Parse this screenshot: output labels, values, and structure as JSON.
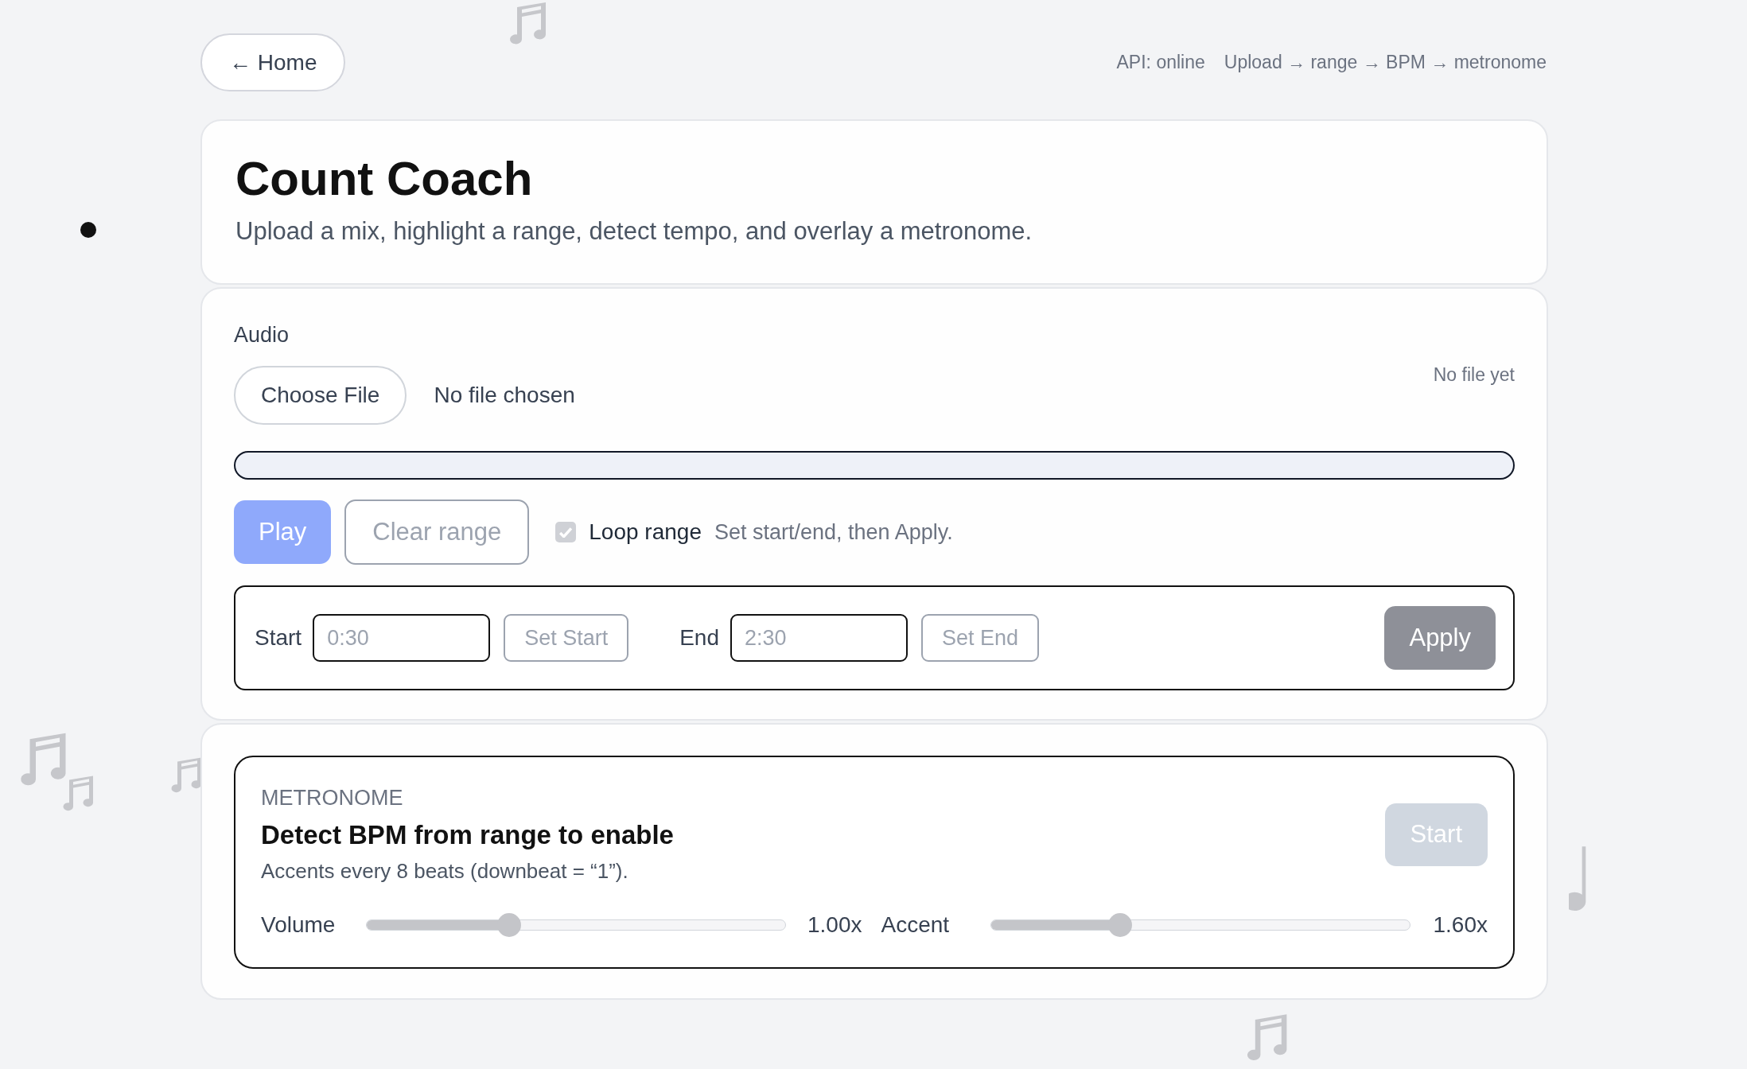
{
  "top_bar": {
    "home_button": {
      "label": "← Home"
    },
    "status_texts": [
      "API: online",
      "Upload → range → BPM → metronome"
    ]
  },
  "header": {
    "title": "Count Coach",
    "subtitle": "Upload a mix, highlight a range, detect tempo, and overlay a metronome."
  },
  "audio": {
    "label": "Audio",
    "choose_button": "Choose File",
    "file_name": "No file chosen",
    "file_status": "No file yet",
    "play_button": {
      "label": "Play",
      "disabled": true
    },
    "clear_button": {
      "label": "Clear range",
      "disabled": true
    },
    "loop": {
      "label": "Loop range",
      "checked": true,
      "disabled": true
    },
    "hint": "Set start/end, then Apply.",
    "range": {
      "start_label": "Start",
      "start_placeholder": "0:30",
      "set_start": "Set Start",
      "end_label": "End",
      "end_placeholder": "2:30",
      "set_end": "Set End",
      "apply_button": {
        "label": "Apply",
        "disabled": true
      }
    }
  },
  "metronome": {
    "kicker": "METRONOME",
    "title": "Detect BPM from range to enable",
    "note": "Accents every 8 beats (downbeat = “1”).",
    "start_button": {
      "label": "Start",
      "disabled": true
    },
    "sliders": [
      {
        "label": "Volume",
        "level": 0.34,
        "reading": "1.00x"
      },
      {
        "label": "Accent",
        "level": 0.31,
        "reading": "1.60x"
      }
    ]
  }
}
